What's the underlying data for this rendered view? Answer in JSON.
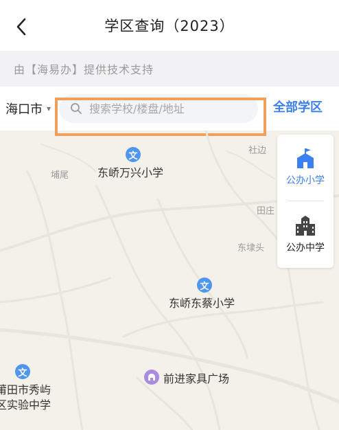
{
  "header": {
    "title": "学区查询（2023）"
  },
  "notice": {
    "text": "由【海易办】提供技术支持"
  },
  "search": {
    "city": "海口市",
    "placeholder": "搜索学校/楼盘/地址",
    "all_link": "全部学区"
  },
  "side_panel": {
    "items": [
      {
        "label": "公办小学",
        "icon": "school-icon",
        "active": true
      },
      {
        "label": "公办中学",
        "icon": "building-icon",
        "active": false
      }
    ]
  },
  "map": {
    "labels": {
      "dongqiao_wanxing": "东峤万兴小学",
      "dongqiao_dongcai": "东峤东蔡小学",
      "qianjin_furniture": "前进家具广场",
      "putian_line1": "莆田市秀屿",
      "putian_line2": "区实验中学",
      "puwei": "埔尾",
      "shebian": "社边",
      "tianzhuang": "田庄",
      "donglitou": "东埭头"
    },
    "poi_glyph": "文"
  },
  "colors": {
    "accent": "#3b7ff0",
    "highlight": "#f0a05a",
    "poi": "#4f96ef"
  }
}
